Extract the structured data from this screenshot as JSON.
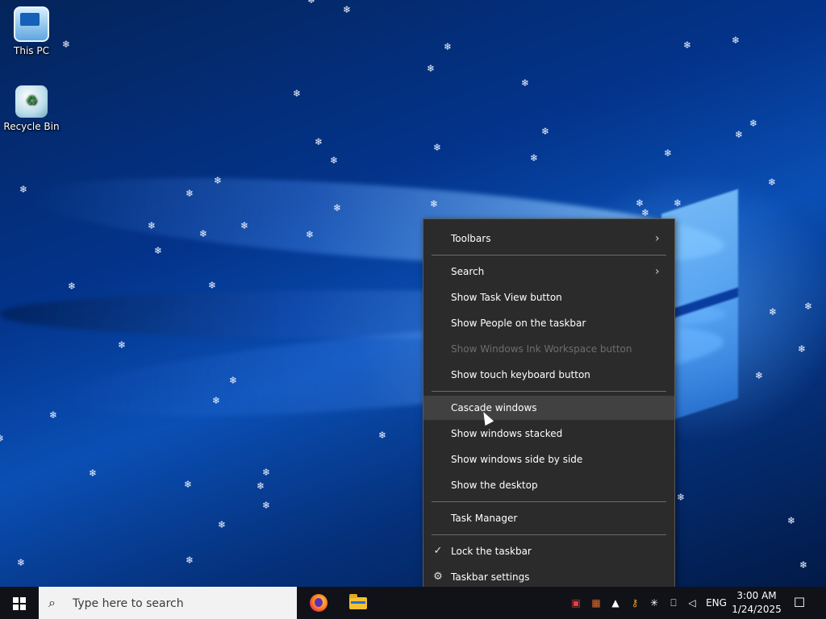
{
  "desktop": {
    "icons": [
      {
        "label": "This PC",
        "icon": "this-pc-icon"
      },
      {
        "label": "Recycle Bin",
        "icon": "recycle-bin-icon"
      }
    ]
  },
  "context_menu": {
    "items": {
      "toolbars": "Toolbars",
      "search": "Search",
      "task_view": "Show Task View button",
      "people": "Show People on the taskbar",
      "ink": "Show Windows Ink Workspace button",
      "touch_keyboard": "Show touch keyboard button",
      "cascade": "Cascade windows",
      "stacked": "Show windows stacked",
      "side_by_side": "Show windows side by side",
      "show_desktop": "Show the desktop",
      "task_manager": "Task Manager",
      "lock": "Lock the taskbar",
      "settings": "Taskbar settings"
    }
  },
  "taskbar": {
    "search_placeholder": "Type here to search",
    "language": "ENG",
    "time": "3:00 AM",
    "date": "1/24/2025"
  }
}
